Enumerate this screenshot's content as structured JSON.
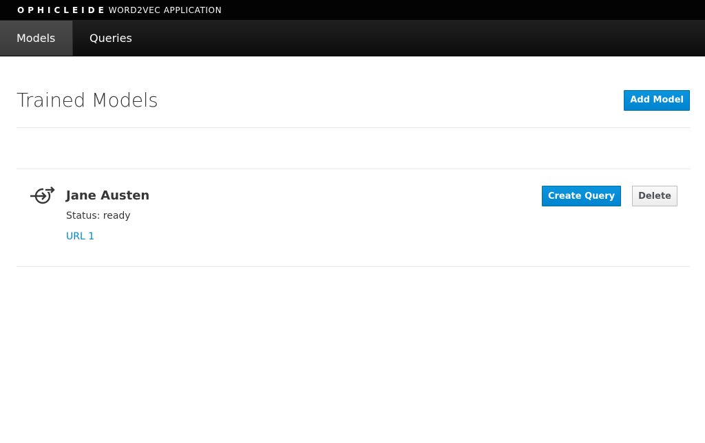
{
  "brand": {
    "logo": "OPHICLEIDE",
    "subtitle": "WORD2VEC APPLICATION"
  },
  "nav": {
    "tabs": [
      {
        "label": "Models",
        "active": true
      },
      {
        "label": "Queries",
        "active": false
      }
    ]
  },
  "page": {
    "title": "Trained Models",
    "add_button": "Add Model"
  },
  "models": [
    {
      "icon": "sync-arrow-icon",
      "name": "Jane Austen",
      "status": "Status: ready",
      "link": "URL 1",
      "create_query_label": "Create Query",
      "delete_label": "Delete"
    }
  ],
  "colors": {
    "primary": "#0088ce",
    "navbar": "#0c0c0c",
    "brandbar": "#030303"
  }
}
